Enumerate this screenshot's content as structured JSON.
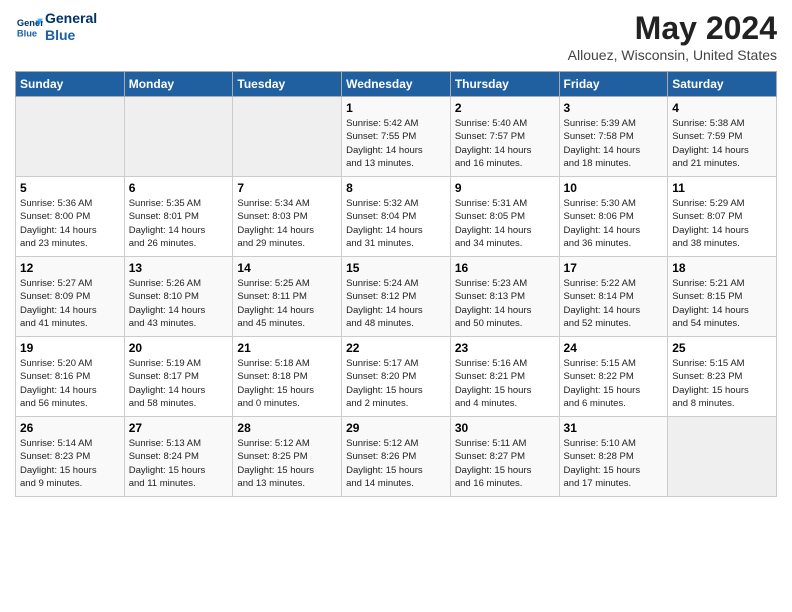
{
  "header": {
    "logo_line1": "General",
    "logo_line2": "Blue",
    "month": "May 2024",
    "location": "Allouez, Wisconsin, United States"
  },
  "days_of_week": [
    "Sunday",
    "Monday",
    "Tuesday",
    "Wednesday",
    "Thursday",
    "Friday",
    "Saturday"
  ],
  "weeks": [
    [
      {
        "day": "",
        "info": ""
      },
      {
        "day": "",
        "info": ""
      },
      {
        "day": "",
        "info": ""
      },
      {
        "day": "1",
        "info": "Sunrise: 5:42 AM\nSunset: 7:55 PM\nDaylight: 14 hours\nand 13 minutes."
      },
      {
        "day": "2",
        "info": "Sunrise: 5:40 AM\nSunset: 7:57 PM\nDaylight: 14 hours\nand 16 minutes."
      },
      {
        "day": "3",
        "info": "Sunrise: 5:39 AM\nSunset: 7:58 PM\nDaylight: 14 hours\nand 18 minutes."
      },
      {
        "day": "4",
        "info": "Sunrise: 5:38 AM\nSunset: 7:59 PM\nDaylight: 14 hours\nand 21 minutes."
      }
    ],
    [
      {
        "day": "5",
        "info": "Sunrise: 5:36 AM\nSunset: 8:00 PM\nDaylight: 14 hours\nand 23 minutes."
      },
      {
        "day": "6",
        "info": "Sunrise: 5:35 AM\nSunset: 8:01 PM\nDaylight: 14 hours\nand 26 minutes."
      },
      {
        "day": "7",
        "info": "Sunrise: 5:34 AM\nSunset: 8:03 PM\nDaylight: 14 hours\nand 29 minutes."
      },
      {
        "day": "8",
        "info": "Sunrise: 5:32 AM\nSunset: 8:04 PM\nDaylight: 14 hours\nand 31 minutes."
      },
      {
        "day": "9",
        "info": "Sunrise: 5:31 AM\nSunset: 8:05 PM\nDaylight: 14 hours\nand 34 minutes."
      },
      {
        "day": "10",
        "info": "Sunrise: 5:30 AM\nSunset: 8:06 PM\nDaylight: 14 hours\nand 36 minutes."
      },
      {
        "day": "11",
        "info": "Sunrise: 5:29 AM\nSunset: 8:07 PM\nDaylight: 14 hours\nand 38 minutes."
      }
    ],
    [
      {
        "day": "12",
        "info": "Sunrise: 5:27 AM\nSunset: 8:09 PM\nDaylight: 14 hours\nand 41 minutes."
      },
      {
        "day": "13",
        "info": "Sunrise: 5:26 AM\nSunset: 8:10 PM\nDaylight: 14 hours\nand 43 minutes."
      },
      {
        "day": "14",
        "info": "Sunrise: 5:25 AM\nSunset: 8:11 PM\nDaylight: 14 hours\nand 45 minutes."
      },
      {
        "day": "15",
        "info": "Sunrise: 5:24 AM\nSunset: 8:12 PM\nDaylight: 14 hours\nand 48 minutes."
      },
      {
        "day": "16",
        "info": "Sunrise: 5:23 AM\nSunset: 8:13 PM\nDaylight: 14 hours\nand 50 minutes."
      },
      {
        "day": "17",
        "info": "Sunrise: 5:22 AM\nSunset: 8:14 PM\nDaylight: 14 hours\nand 52 minutes."
      },
      {
        "day": "18",
        "info": "Sunrise: 5:21 AM\nSunset: 8:15 PM\nDaylight: 14 hours\nand 54 minutes."
      }
    ],
    [
      {
        "day": "19",
        "info": "Sunrise: 5:20 AM\nSunset: 8:16 PM\nDaylight: 14 hours\nand 56 minutes."
      },
      {
        "day": "20",
        "info": "Sunrise: 5:19 AM\nSunset: 8:17 PM\nDaylight: 14 hours\nand 58 minutes."
      },
      {
        "day": "21",
        "info": "Sunrise: 5:18 AM\nSunset: 8:18 PM\nDaylight: 15 hours\nand 0 minutes."
      },
      {
        "day": "22",
        "info": "Sunrise: 5:17 AM\nSunset: 8:20 PM\nDaylight: 15 hours\nand 2 minutes."
      },
      {
        "day": "23",
        "info": "Sunrise: 5:16 AM\nSunset: 8:21 PM\nDaylight: 15 hours\nand 4 minutes."
      },
      {
        "day": "24",
        "info": "Sunrise: 5:15 AM\nSunset: 8:22 PM\nDaylight: 15 hours\nand 6 minutes."
      },
      {
        "day": "25",
        "info": "Sunrise: 5:15 AM\nSunset: 8:23 PM\nDaylight: 15 hours\nand 8 minutes."
      }
    ],
    [
      {
        "day": "26",
        "info": "Sunrise: 5:14 AM\nSunset: 8:23 PM\nDaylight: 15 hours\nand 9 minutes."
      },
      {
        "day": "27",
        "info": "Sunrise: 5:13 AM\nSunset: 8:24 PM\nDaylight: 15 hours\nand 11 minutes."
      },
      {
        "day": "28",
        "info": "Sunrise: 5:12 AM\nSunset: 8:25 PM\nDaylight: 15 hours\nand 13 minutes."
      },
      {
        "day": "29",
        "info": "Sunrise: 5:12 AM\nSunset: 8:26 PM\nDaylight: 15 hours\nand 14 minutes."
      },
      {
        "day": "30",
        "info": "Sunrise: 5:11 AM\nSunset: 8:27 PM\nDaylight: 15 hours\nand 16 minutes."
      },
      {
        "day": "31",
        "info": "Sunrise: 5:10 AM\nSunset: 8:28 PM\nDaylight: 15 hours\nand 17 minutes."
      },
      {
        "day": "",
        "info": ""
      }
    ]
  ]
}
